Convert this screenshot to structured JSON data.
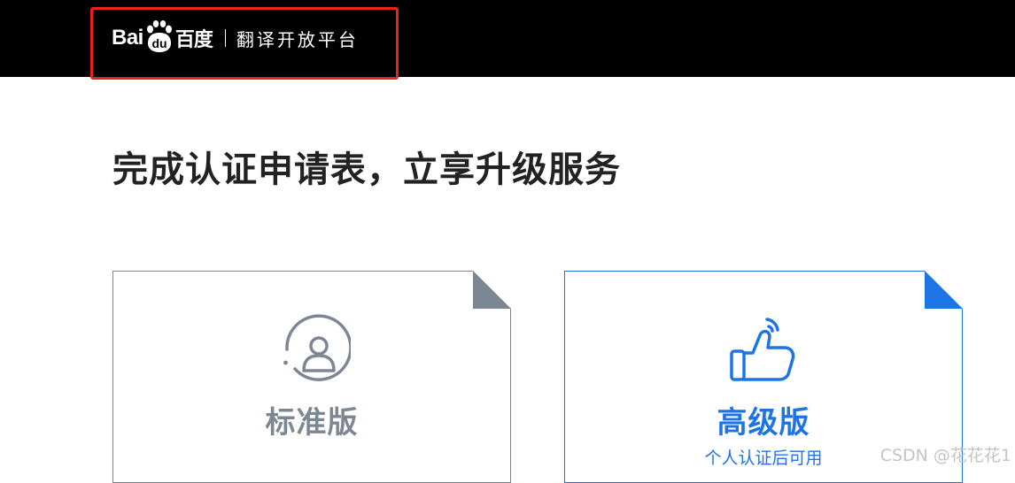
{
  "header": {
    "logo_latin": "Bai",
    "logo_du": "du",
    "logo_chinese": "百度",
    "subtitle": "翻译开放平台"
  },
  "main": {
    "title": "完成认证申请表，立享升级服务"
  },
  "plans": [
    {
      "name": "标准版",
      "icon": "user-icon",
      "note": ""
    },
    {
      "name": "高级版",
      "icon": "thumbs-up-icon",
      "note": "个人认证后可用"
    }
  ],
  "watermark": "CSDN @花花花1",
  "colors": {
    "header_bg": "#000000",
    "highlight": "#e8231c",
    "standard_gray": "#7d8794",
    "advanced_blue": "#1d74e4",
    "title_text": "#222222"
  }
}
